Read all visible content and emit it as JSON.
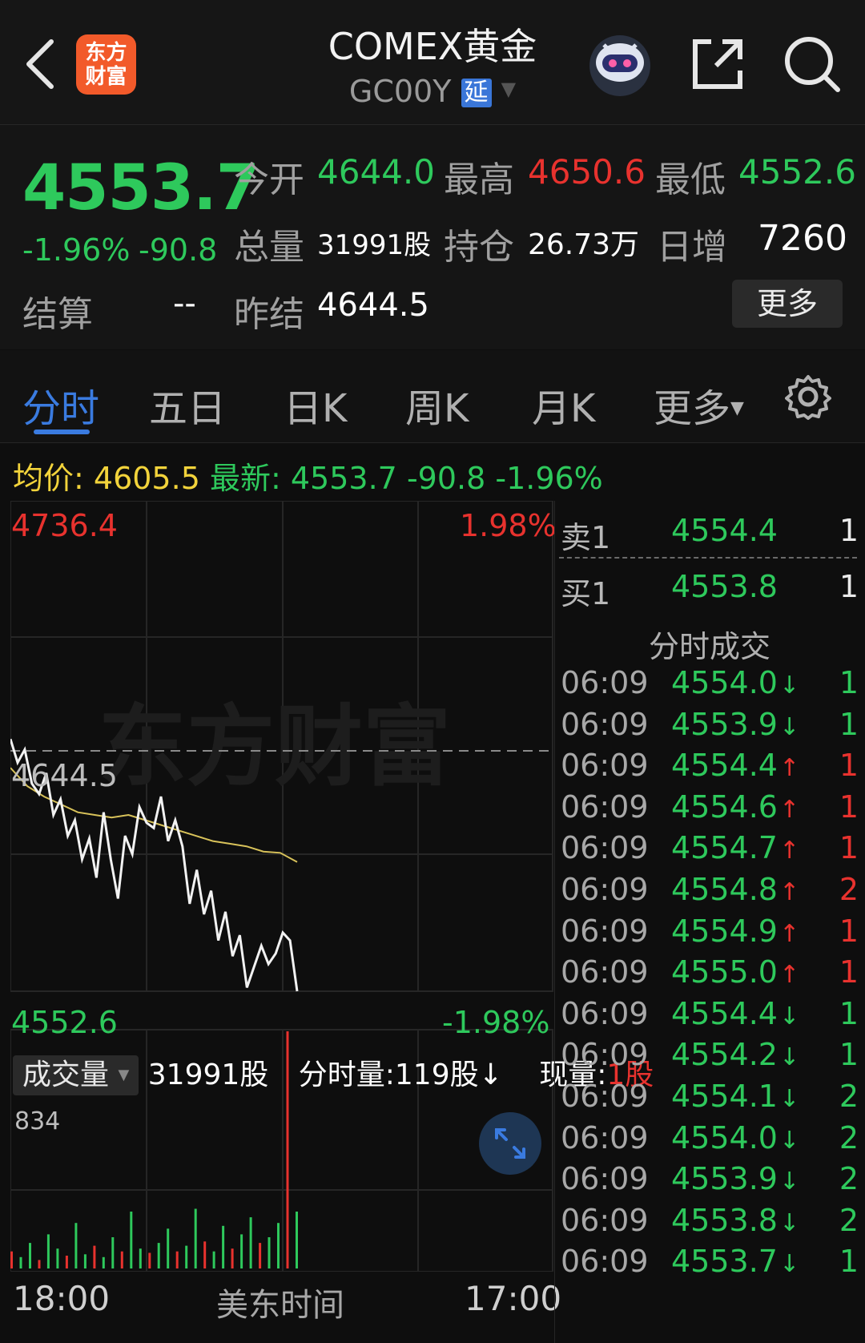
{
  "header": {
    "title": "COMEX黄金",
    "code": "GC00Y",
    "delay_badge": "延",
    "logo_line1": "东方",
    "logo_line2": "财富"
  },
  "quote": {
    "last_price": "4553.7",
    "change_pct": "-1.96%",
    "change_abs": "-90.8",
    "open_label": "今开",
    "open_value": "4644.0",
    "high_label": "最高",
    "high_value": "4650.6",
    "low_label": "最低",
    "low_value": "4552.6",
    "volume_label": "总量",
    "volume_value": "31991股",
    "oi_label": "持仓",
    "oi_value": "26.73万",
    "daily_inc_label": "日增",
    "daily_inc_value": "7260",
    "settle_label": "结算",
    "settle_value": "--",
    "prev_settle_label": "昨结",
    "prev_settle_value": "4644.5",
    "more_label": "更多"
  },
  "tabs": [
    "分时",
    "五日",
    "日K",
    "周K",
    "月K",
    "更多"
  ],
  "info_line": {
    "avg_label": "均价:",
    "avg_value": "4605.5",
    "latest_label": "最新:",
    "latest_value": "4553.7",
    "change_abs": "-90.8",
    "change_pct": "-1.96%"
  },
  "chart": {
    "y_max_label": "4736.4",
    "y_min_label": "4552.6",
    "ref_label": "4644.5",
    "pct_top_label": "1.98%",
    "pct_bottom_label": "-1.98%",
    "watermark": "东方财富",
    "volume_select": "成交量",
    "volume_total": "31991股",
    "minute_volume": "分时量:119股↓",
    "current_volume_label": "现量:",
    "current_volume_value": "1股",
    "volume_max_label": "834",
    "time_start": "18:00",
    "time_mid": "美东时间",
    "time_end": "17:00"
  },
  "chart_data": {
    "type": "line",
    "title": "",
    "xlabel": "",
    "ylabel": "",
    "ylim": [
      4552.6,
      4736.4
    ],
    "reference_line": 4644.5,
    "series": [
      {
        "values": [
          4649,
          4640,
          4645,
          4632,
          4628,
          4636,
          4620,
          4626,
          4612,
          4618,
          4603,
          4611,
          4596,
          4621,
          4603,
          4588,
          4612,
          4605,
          4623,
          4617,
          4615,
          4627,
          4610,
          4618,
          4608,
          4586,
          4599,
          4582,
          4591,
          4572,
          4583,
          4566,
          4574,
          4554,
          4562,
          4570,
          4563,
          4567,
          4575,
          4572,
          4552.6
        ]
      },
      {
        "values": [
          4638,
          4631,
          4627,
          4624,
          4621,
          4620,
          4619,
          4620,
          4618,
          4616,
          4614,
          4612,
          4610,
          4609,
          4608,
          4606,
          4605.5,
          4602
        ]
      }
    ],
    "volume": [
      60,
      40,
      90,
      30,
      120,
      70,
      45,
      160,
      50,
      80,
      40,
      110,
      60,
      200,
      70,
      55,
      90,
      140,
      60,
      80,
      210,
      95,
      60,
      150,
      70,
      120,
      180,
      90,
      110,
      160,
      834,
      200
    ]
  },
  "orderbook": {
    "ask_label": "卖1",
    "ask_price": "4554.4",
    "ask_vol": "1",
    "bid_label": "买1",
    "bid_price": "4553.8",
    "bid_vol": "1",
    "trades_title": "分时成交",
    "trades": [
      {
        "time": "06:09",
        "price": "4554.0",
        "arrow": "↓",
        "vol": "1",
        "dir": "down"
      },
      {
        "time": "06:09",
        "price": "4553.9",
        "arrow": "↓",
        "vol": "1",
        "dir": "down"
      },
      {
        "time": "06:09",
        "price": "4554.4",
        "arrow": "↑",
        "vol": "1",
        "dir": "up"
      },
      {
        "time": "06:09",
        "price": "4554.6",
        "arrow": "↑",
        "vol": "1",
        "dir": "up"
      },
      {
        "time": "06:09",
        "price": "4554.7",
        "arrow": "↑",
        "vol": "1",
        "dir": "up"
      },
      {
        "time": "06:09",
        "price": "4554.8",
        "arrow": "↑",
        "vol": "2",
        "dir": "up"
      },
      {
        "time": "06:09",
        "price": "4554.9",
        "arrow": "↑",
        "vol": "1",
        "dir": "up"
      },
      {
        "time": "06:09",
        "price": "4555.0",
        "arrow": "↑",
        "vol": "1",
        "dir": "up"
      },
      {
        "time": "06:09",
        "price": "4554.4",
        "arrow": "↓",
        "vol": "1",
        "dir": "down"
      },
      {
        "time": "06:09",
        "price": "4554.2",
        "arrow": "↓",
        "vol": "1",
        "dir": "down"
      },
      {
        "time": "06:09",
        "price": "4554.1",
        "arrow": "↓",
        "vol": "2",
        "dir": "down"
      },
      {
        "time": "06:09",
        "price": "4554.0",
        "arrow": "↓",
        "vol": "2",
        "dir": "down"
      },
      {
        "time": "06:09",
        "price": "4553.9",
        "arrow": "↓",
        "vol": "2",
        "dir": "down"
      },
      {
        "time": "06:09",
        "price": "4553.8",
        "arrow": "↓",
        "vol": "2",
        "dir": "down"
      },
      {
        "time": "06:09",
        "price": "4553.7",
        "arrow": "↓",
        "vol": "1",
        "dir": "down"
      }
    ]
  },
  "colors": {
    "up": "#e8322e",
    "down": "#2ec95c",
    "avg_line": "#d8c25a",
    "accent": "#3a7be0"
  }
}
